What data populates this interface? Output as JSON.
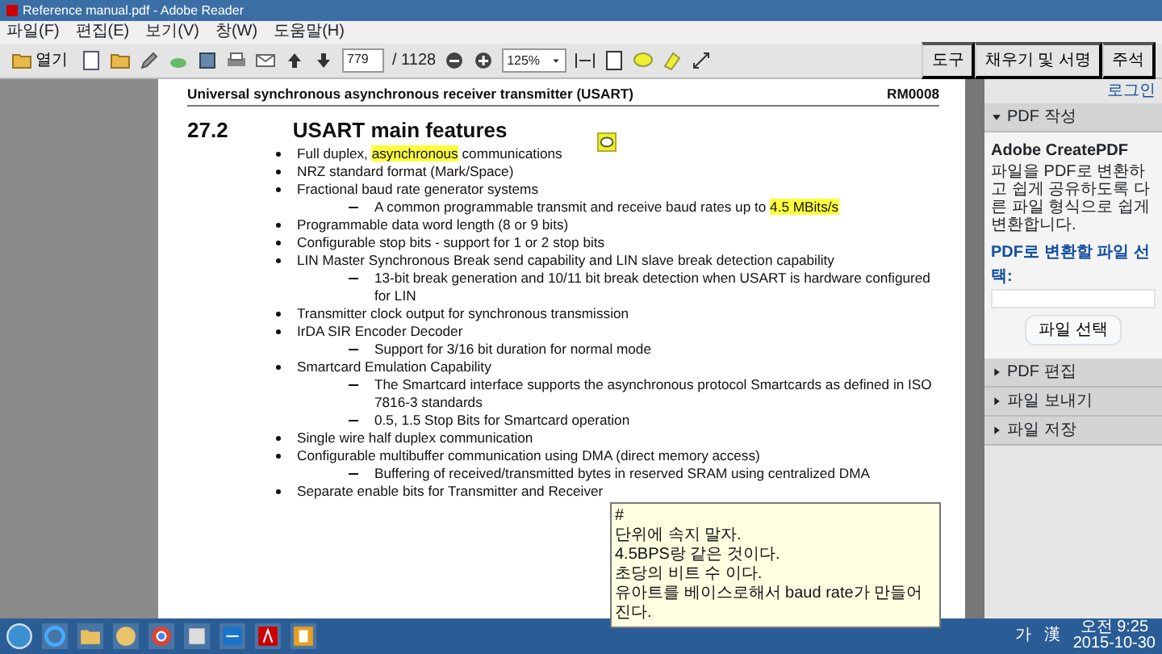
{
  "window": {
    "title": "Reference manual.pdf - Adobe Reader"
  },
  "menu": [
    "파일(F)",
    "편집(E)",
    "보기(V)",
    "창(W)",
    "도움말(H)"
  ],
  "toolbar": {
    "open_label": "열기",
    "page": "779",
    "page_total": "/ 1128",
    "zoom": "125%"
  },
  "panel_tabs": [
    {
      "label": "도구",
      "selected": false
    },
    {
      "label": "채우기 및 서명",
      "selected": false
    },
    {
      "label": "주석",
      "selected": false
    }
  ],
  "right_panel": {
    "link": "로그인",
    "service": "Adobe CreatePDF",
    "description": "파일을 PDF로 변환하고 쉽게 공유하도록 다른 파일 형식으로 쉽게 변환합니다.",
    "field_label": "PDF로 변환할 파일 선택:",
    "button": "파일 선택",
    "sections": [
      {
        "title": "PDF 작성",
        "expanded": true
      },
      {
        "title": "PDF 편집",
        "expanded": false
      },
      {
        "title": "파일 보내기",
        "expanded": false
      },
      {
        "title": "파일 저장",
        "expanded": false
      }
    ]
  },
  "document": {
    "header_left": "Universal synchronous asynchronous receiver transmitter (USART)",
    "header_right": "RM0008",
    "section_number": "27.2",
    "section_title": "USART main features",
    "items": [
      {
        "parts": [
          {
            "text": "Full duplex, ",
            "highlighted": false
          },
          {
            "text": "asynchronous",
            "highlighted": true
          },
          {
            "text": " communications",
            "highlighted": false
          }
        ]
      },
      {
        "text": "NRZ standard format (Mark/Space)"
      },
      {
        "text": "Fractional baud rate generator systems",
        "children": [
          {
            "parts": [
              {
                "text": "A common programmable transmit and receive baud rates up to ",
                "highlighted": false
              },
              {
                "text": "4.5 MBits/s",
                "highlighted": true
              }
            ]
          }
        ]
      },
      {
        "text": "Programmable data word length (8 or 9 bits)"
      },
      {
        "text": "Configurable stop bits - support for 1 or 2 stop bits"
      },
      {
        "text": "LIN Master Synchronous Break send capability and LIN slave break detection capability",
        "children": [
          {
            "text": "13-bit break generation and 10/11 bit break detection when USART is hardware configured for LIN"
          }
        ]
      },
      {
        "text": "Transmitter clock output for synchronous transmission"
      },
      {
        "text": "IrDA SIR Encoder Decoder",
        "children": [
          {
            "text": "Support for 3/16 bit duration for normal mode"
          }
        ]
      },
      {
        "text": "Smartcard Emulation Capability",
        "children": [
          {
            "text": "The Smartcard interface supports the asynchronous protocol Smartcards as defined in ISO 7816-3 standards"
          },
          {
            "text": "0.5, 1.5 Stop Bits for Smartcard operation"
          }
        ]
      },
      {
        "text": "Single wire half duplex communication"
      },
      {
        "text": "Configurable multibuffer communication using DMA (direct memory access)",
        "children": [
          {
            "text": "Buffering of received/transmitted bytes in reserved SRAM using centralized DMA"
          }
        ]
      },
      {
        "text": "Separate enable bits for Transmitter and Receiver"
      }
    ]
  },
  "note": {
    "title": "#",
    "lines": [
      "단위에 속지 말자.",
      "4.5BPS랑 같은 것이다.",
      "초당의 비트 수 이다.",
      "유아트를 베이스로해서 baud rate가 만들어 진다."
    ]
  },
  "taskbar": {
    "ime": [
      "가",
      "漢"
    ],
    "time": "오전 9:25",
    "date": "2015-10-30"
  }
}
